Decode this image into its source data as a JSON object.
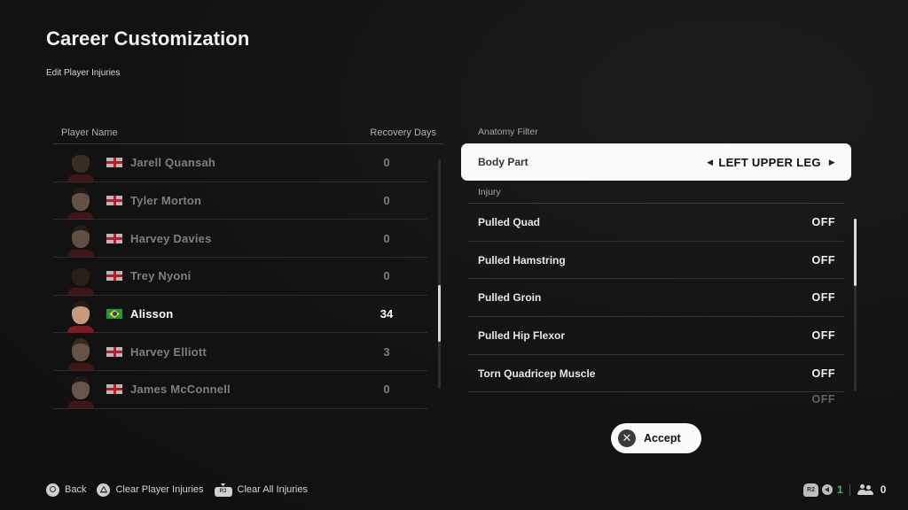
{
  "header": {
    "title": "Career Customization",
    "subtitle": "Edit Player Injuries"
  },
  "player_list": {
    "columns": [
      "Player Name",
      "Recovery Days"
    ],
    "rows": [
      {
        "name": "Jarell Quansah",
        "nation": "England",
        "flag_icon": "england-flag-icon",
        "recovery_days": "0",
        "selected": false,
        "skin": "#6b4a38",
        "hair": "#1c1410"
      },
      {
        "name": "Tyler Morton",
        "nation": "England",
        "flag_icon": "england-flag-icon",
        "recovery_days": "0",
        "selected": false,
        "skin": "#c99b83",
        "hair": "#3a2417"
      },
      {
        "name": "Harvey Davies",
        "nation": "England",
        "flag_icon": "england-flag-icon",
        "recovery_days": "0",
        "selected": false,
        "skin": "#c39a80",
        "hair": "#3b2a1e"
      },
      {
        "name": "Trey Nyoni",
        "nation": "England",
        "flag_icon": "england-flag-icon",
        "recovery_days": "0",
        "selected": false,
        "skin": "#4a3024",
        "hair": "#171010"
      },
      {
        "name": "Alisson",
        "nation": "Brazil",
        "flag_icon": "brazil-flag-icon",
        "recovery_days": "34",
        "selected": true,
        "skin": "#c79a7c",
        "hair": "#2a1c14"
      },
      {
        "name": "Harvey Elliott",
        "nation": "England",
        "flag_icon": "england-flag-icon",
        "recovery_days": "3",
        "selected": false,
        "skin": "#d1a186",
        "hair": "#6a4a2a"
      },
      {
        "name": "James McConnell",
        "nation": "England",
        "flag_icon": "england-flag-icon",
        "recovery_days": "0",
        "selected": false,
        "skin": "#d3a88f",
        "hair": "#3d2618"
      }
    ],
    "scroll_position": 0.73
  },
  "anatomy_filter": {
    "section_label": "Anatomy Filter",
    "body_part_label": "Body Part",
    "body_part_value": "LEFT UPPER LEG",
    "injury_section_label": "Injury",
    "injuries": [
      {
        "name": "Pulled Quad",
        "status": "OFF"
      },
      {
        "name": "Pulled Hamstring",
        "status": "OFF"
      },
      {
        "name": "Pulled Groin",
        "status": "OFF"
      },
      {
        "name": "Pulled Hip Flexor",
        "status": "OFF"
      },
      {
        "name": "Torn Quadricep Muscle",
        "status": "OFF"
      },
      {
        "name": "",
        "status": "OFF"
      }
    ],
    "scroll_position": 0.0
  },
  "accept_button": {
    "label": "Accept",
    "icon": "cross-button-icon"
  },
  "footer": {
    "actions": [
      {
        "icon": "circle-button-icon",
        "label": "Back"
      },
      {
        "icon": "triangle-button-icon",
        "label": "Clear Player Injuries"
      },
      {
        "icon": "r3-button-icon",
        "glyph_text": "R3",
        "label": "Clear All Injuries"
      }
    ]
  },
  "status_bar": {
    "r2_glyph_text": "R2",
    "online_count": "1",
    "users_count": "0",
    "accent_green": "#3cc25a"
  }
}
